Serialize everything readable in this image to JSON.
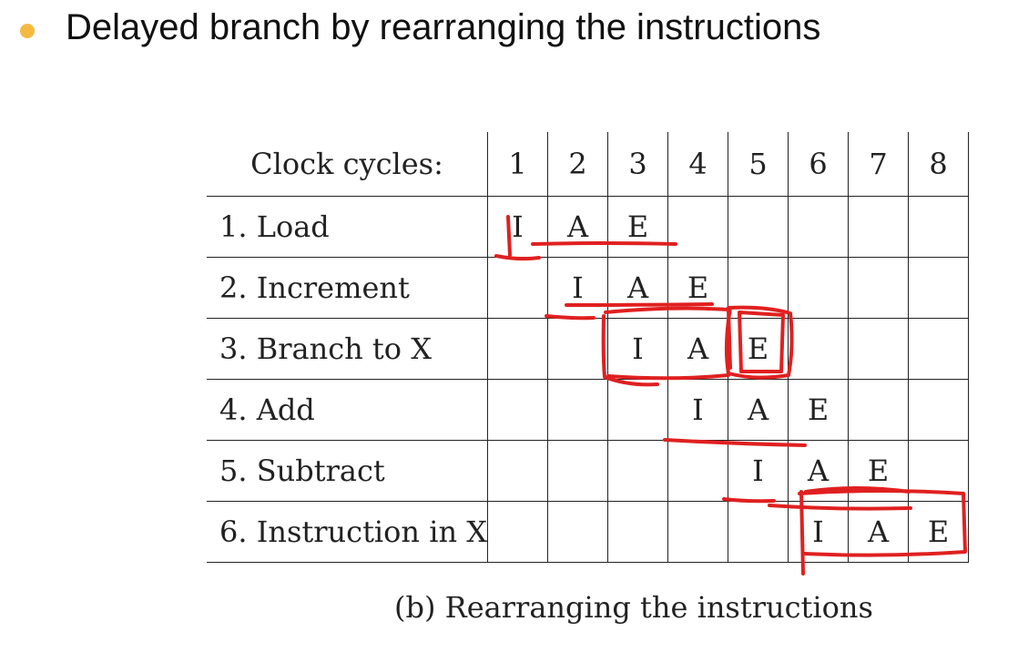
{
  "slide": {
    "title": "Delayed branch by rearranging the instructions",
    "bullet_color": "#f5b942"
  },
  "table": {
    "header_label": "Clock cycles:",
    "cycles": [
      "1",
      "2",
      "3",
      "4",
      "5",
      "6",
      "7",
      "8"
    ],
    "rows": [
      {
        "label": "1. Load",
        "cells": [
          "I",
          "A",
          "E",
          "",
          "",
          "",
          "",
          ""
        ]
      },
      {
        "label": "2. Increment",
        "cells": [
          "",
          "I",
          "A",
          "E",
          "",
          "",
          "",
          ""
        ]
      },
      {
        "label": "3. Branch to X",
        "cells": [
          "",
          "",
          "I",
          "A",
          "E",
          "",
          "",
          ""
        ]
      },
      {
        "label": "4. Add",
        "cells": [
          "",
          "",
          "",
          "I",
          "A",
          "E",
          "",
          ""
        ]
      },
      {
        "label": "5. Subtract",
        "cells": [
          "",
          "",
          "",
          "",
          "I",
          "A",
          "E",
          ""
        ]
      },
      {
        "label": "6. Instruction in X",
        "cells": [
          "",
          "",
          "",
          "",
          "",
          "I",
          "A",
          "E"
        ]
      }
    ]
  },
  "caption": "(b) Rearranging the instructions",
  "annotation_color": "#e02020"
}
